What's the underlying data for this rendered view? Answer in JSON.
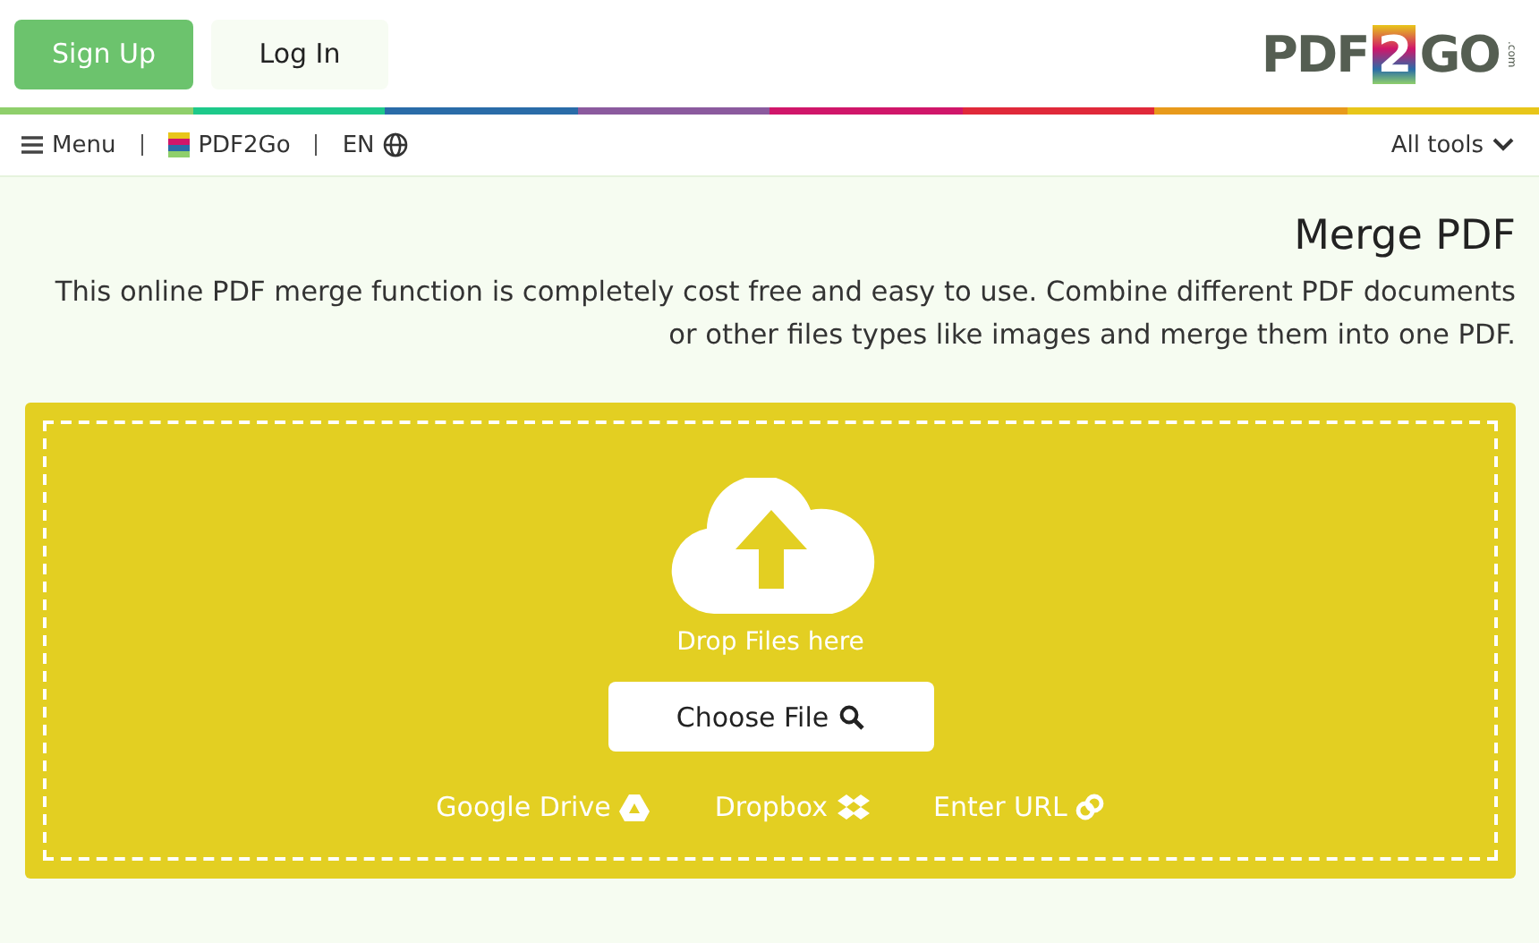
{
  "header_buttons": [
    {
      "label": "Sign Up",
      "kind": "primary"
    },
    {
      "label": "Log In",
      "kind": "plain"
    }
  ],
  "logo": {
    "text_start": "PDF",
    "badge": "2",
    "text_end": "GO",
    "domain": ".com"
  },
  "nav": {
    "menu": "Menu",
    "brand": "PDF2Go",
    "language": "EN",
    "all_tools": "All tools"
  },
  "page": {
    "title": "Merge PDF",
    "description": "This online PDF merge function is completely cost free and easy to use. Combine different PDF documents or other files types like images and merge them into one PDF."
  },
  "dropzone": {
    "hint": "Drop Files here",
    "choose_button": "Choose File",
    "sources": [
      {
        "label": "Google Drive",
        "kind": "drive"
      },
      {
        "label": "Dropbox",
        "kind": "dropbox"
      },
      {
        "label": "Enter URL",
        "kind": "link"
      }
    ]
  }
}
